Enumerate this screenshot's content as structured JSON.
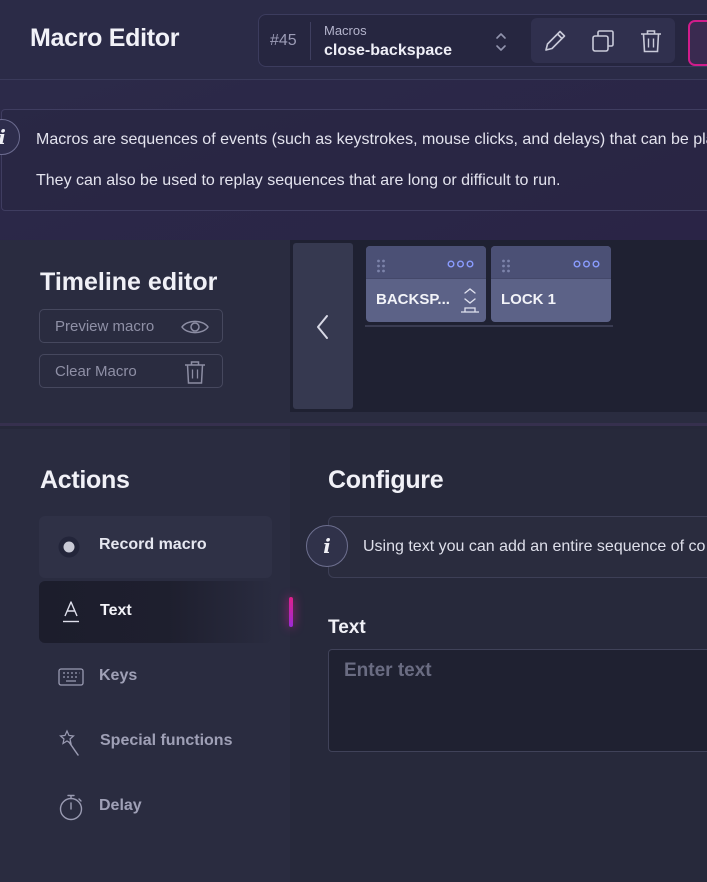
{
  "header": {
    "title": "Macro Editor",
    "macro_number": "#45",
    "macro_select_label": "Macros",
    "macro_select_value": "close-backspace"
  },
  "info": {
    "line1": "Macros are sequences of events (such as keystrokes, mouse clicks, and delays) that can be pla",
    "line2": "They can also be used to replay sequences that are long or difficult to run."
  },
  "timeline": {
    "title": "Timeline editor",
    "preview_label": "Preview macro",
    "clear_label": "Clear Macro",
    "steps": [
      {
        "label": "BACKSP..."
      },
      {
        "label": "LOCK 1"
      }
    ]
  },
  "actions": {
    "title": "Actions",
    "items": [
      {
        "label": "Record macro"
      },
      {
        "label": "Text"
      },
      {
        "label": "Keys"
      },
      {
        "label": "Special functions"
      },
      {
        "label": "Delay"
      }
    ]
  },
  "configure": {
    "title": "Configure",
    "info_text": "Using text you can add an entire sequence of co",
    "text_label": "Text",
    "text_placeholder": "Enter text",
    "text_value": ""
  },
  "colors": {
    "accent": "#d01c8b",
    "accent_secondary": "#9b2ad6",
    "card": "#5c6287",
    "dots": "#8a9cff"
  },
  "icons": {
    "edit": "pencil-icon",
    "duplicate": "copy-icon",
    "delete": "trash-icon",
    "preview": "eye-icon",
    "clear": "trash-icon",
    "prev": "chevron-left-icon",
    "record": "record-dot-icon",
    "text": "text-a-icon",
    "keys": "keyboard-icon",
    "special": "magic-wand-icon",
    "delay": "stopwatch-icon"
  }
}
